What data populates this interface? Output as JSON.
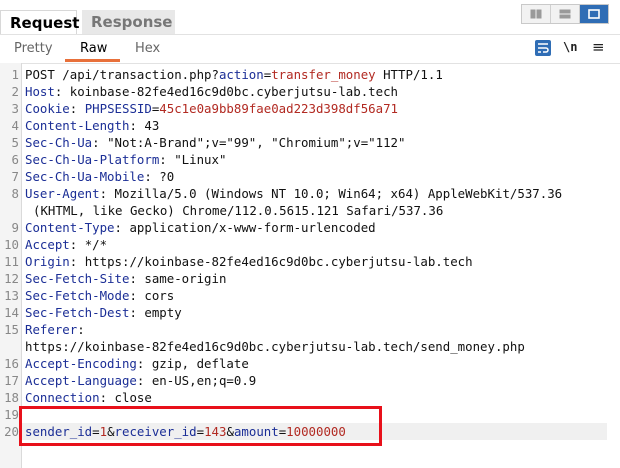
{
  "tabs": [
    {
      "label": "Request",
      "active": true
    },
    {
      "label": "Response",
      "active": false
    }
  ],
  "layout_buttons": [
    {
      "icon": "split-vertical-icon",
      "active": false
    },
    {
      "icon": "split-horizontal-icon",
      "active": false
    },
    {
      "icon": "single-pane-icon",
      "active": true
    }
  ],
  "subtabs": [
    {
      "label": "Pretty",
      "active": false
    },
    {
      "label": "Raw",
      "active": true
    },
    {
      "label": "Hex",
      "active": false
    }
  ],
  "toolbar": {
    "wrap_icon": "text-wrap-icon",
    "newline_label": "\\n",
    "menu_icon": "hamburger-menu-icon"
  },
  "colors": {
    "accent_orange": "#e8703a",
    "accent_blue": "#2f6db5",
    "header_name": "#1b2e96",
    "param_value": "#b22a22",
    "highlight_red": "#e8101a"
  },
  "request": {
    "request_line": {
      "method_path": "POST /api/transaction.php?",
      "param_name": "action",
      "equals": "=",
      "param_value": "transfer_money",
      "version": " HTTP/1.1"
    },
    "headers": [
      {
        "name": "Host",
        "value": "koinbase-82fe4ed16c9d0bc.cyberjutsu-lab.tech"
      },
      {
        "name": "Cookie",
        "cookie_name": "PHPSESSID",
        "cookie_value": "45c1e0a9bb89fae0ad223d398df56a71"
      },
      {
        "name": "Content-Length",
        "value": "43"
      },
      {
        "name": "Sec-Ch-Ua",
        "value": "\"Not:A-Brand\";v=\"99\", \"Chromium\";v=\"112\""
      },
      {
        "name": "Sec-Ch-Ua-Platform",
        "value": "\"Linux\""
      },
      {
        "name": "Sec-Ch-Ua-Mobile",
        "value": "?0"
      },
      {
        "name": "User-Agent",
        "value": "Mozilla/5.0 (Windows NT 10.0; Win64; x64) AppleWebKit/537.36",
        "value_cont": "(KHTML, like Gecko) Chrome/112.0.5615.121 Safari/537.36"
      },
      {
        "name": "Content-Type",
        "value": "application/x-www-form-urlencoded"
      },
      {
        "name": "Accept",
        "value": "*/*"
      },
      {
        "name": "Origin",
        "value": "https://koinbase-82fe4ed16c9d0bc.cyberjutsu-lab.tech"
      },
      {
        "name": "Sec-Fetch-Site",
        "value": "same-origin"
      },
      {
        "name": "Sec-Fetch-Mode",
        "value": "cors"
      },
      {
        "name": "Sec-Fetch-Dest",
        "value": "empty"
      },
      {
        "name": "Referer",
        "value": "",
        "value_cont": "https://koinbase-82fe4ed16c9d0bc.cyberjutsu-lab.tech/send_money.php"
      },
      {
        "name": "Accept-Encoding",
        "value": "gzip, deflate"
      },
      {
        "name": "Accept-Language",
        "value": "en-US,en;q=0.9"
      },
      {
        "name": "Connection",
        "value": "close"
      }
    ],
    "body": [
      {
        "key": "sender_id",
        "value": "1"
      },
      {
        "key": "receiver_id",
        "value": "143"
      },
      {
        "key": "amount",
        "value": "10000000"
      }
    ],
    "line_numbers": [
      "1",
      "2",
      "3",
      "4",
      "5",
      "6",
      "7",
      "8",
      "9",
      "10",
      "11",
      "12",
      "13",
      "14",
      "15",
      "16",
      "17",
      "18",
      "19",
      "20"
    ],
    "separators": {
      "colon_space": ": ",
      "colon": ":",
      "eq": "=",
      "amp": "&"
    }
  }
}
